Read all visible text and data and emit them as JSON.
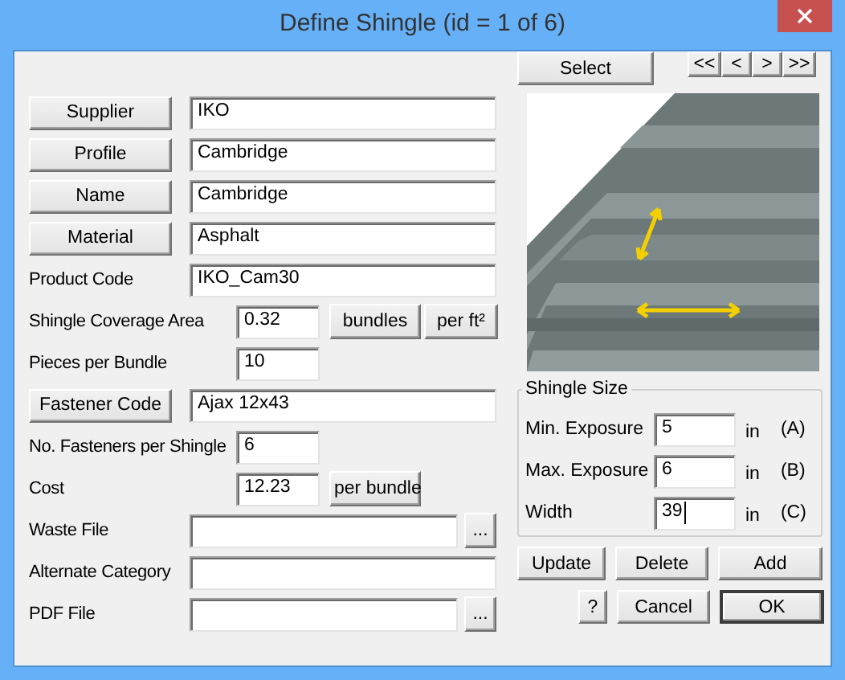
{
  "window": {
    "title": "Define Shingle (id = 1 of 6)"
  },
  "select_button": "Select",
  "nav_buttons": [
    "<<",
    "<",
    ">",
    ">>"
  ],
  "fields": [
    {
      "kind": "lookup",
      "label": "Supplier",
      "value": "IKO"
    },
    {
      "kind": "lookup",
      "label": "Profile",
      "value": "Cambridge"
    },
    {
      "kind": "lookup",
      "label": "Name",
      "value": "Cambridge"
    },
    {
      "kind": "lookup",
      "label": "Material",
      "value": "Asphalt"
    },
    {
      "kind": "text",
      "label": "Product Code",
      "value": "IKO_Cam30"
    },
    {
      "kind": "number",
      "label": "Shingle Coverage Area",
      "value": "0.32",
      "units": [
        "bundles",
        "per ft²"
      ]
    },
    {
      "kind": "number",
      "label": "Pieces per Bundle",
      "value": "10"
    },
    {
      "kind": "lookup",
      "label": "Fastener Code",
      "value": "Ajax 12x43"
    },
    {
      "kind": "number",
      "label": "No. Fasteners per Shingle",
      "value": "6"
    },
    {
      "kind": "number",
      "label": "Cost",
      "value": "12.23",
      "units": [
        "per bundle"
      ]
    },
    {
      "kind": "file",
      "label": "Waste File",
      "browse": "..."
    },
    {
      "kind": "text",
      "label": "Alternate Category"
    },
    {
      "kind": "file",
      "label": "PDF File",
      "browse": "..."
    }
  ],
  "shingle_size": {
    "title": "Shingle Size",
    "rows": [
      {
        "label": "Min. Exposure",
        "value": "5",
        "unit": "in",
        "tag": "(A)",
        "focused": false
      },
      {
        "label": "Max. Exposure",
        "value": "6",
        "unit": "in",
        "tag": "(B)",
        "focused": false
      },
      {
        "label": "Width",
        "value": "39",
        "unit": "in",
        "tag": "(C)",
        "focused": true
      }
    ]
  },
  "action_rows": [
    [
      {
        "label": "Update",
        "default": false
      },
      {
        "label": "Delete",
        "default": false
      },
      {
        "label": "Add",
        "default": false
      }
    ],
    [
      {
        "label": "?",
        "default": false
      },
      {
        "label": "Cancel",
        "default": false
      },
      {
        "label": "OK",
        "default": true
      }
    ]
  ]
}
